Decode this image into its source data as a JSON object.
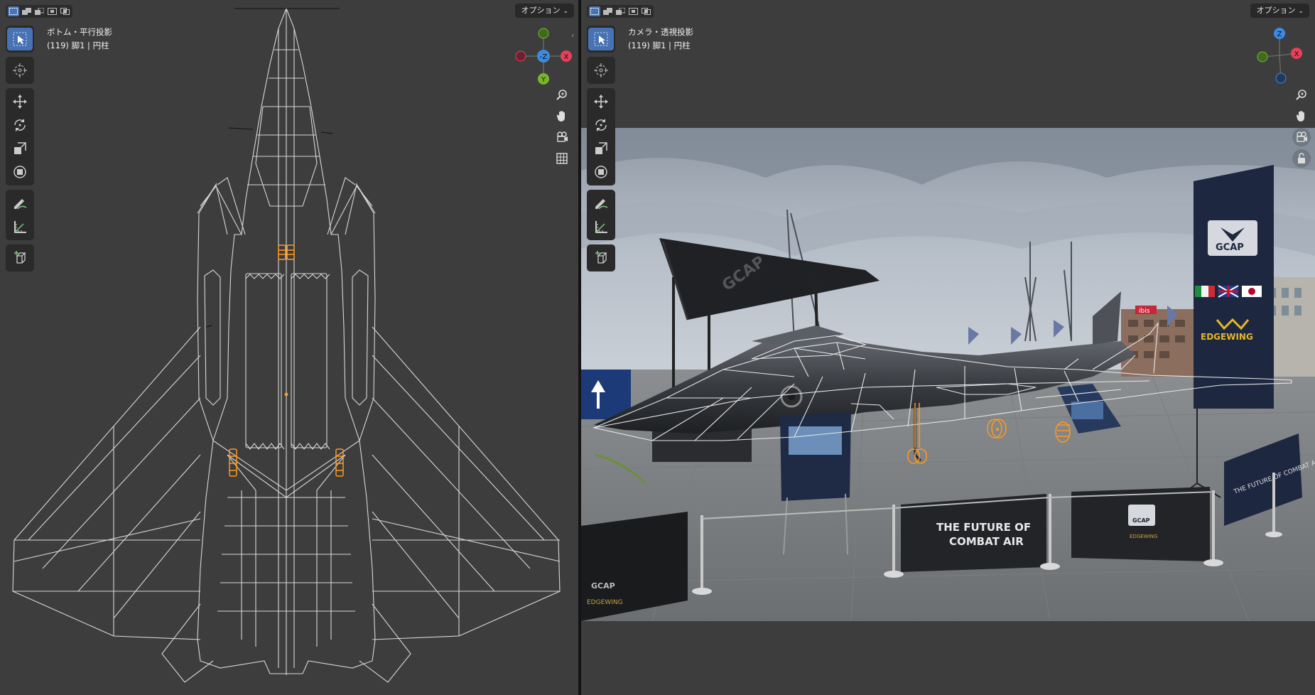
{
  "left_viewport": {
    "view_name": "ボトム・平行投影",
    "object_info": "(119) 脚1 | 円柱",
    "options_label": "オプション",
    "gizmo": {
      "z_label": "-Z",
      "x_label": "X",
      "y_label": "Y"
    }
  },
  "right_viewport": {
    "view_name": "カメラ・透視投影",
    "object_info": "(119) 脚1 | 円柱",
    "options_label": "オプション",
    "gizmo": {
      "z_label": "Z",
      "x_label": "X"
    },
    "scene_text": {
      "banner_brand": "GCAP",
      "banner_sub": "EDGEWING",
      "fence_line1": "THE FUTURE OF",
      "fence_line2": "COMBAT AIR",
      "fence_right": "THE FUTURE OF COMBAT AIR",
      "fence_left_brand": "GCAP",
      "fence_left_sub": "EDGEWING",
      "fence_mid_brand": "GCAP",
      "fence_mid_sub": "EDGEWING",
      "hotel_sign": "ibis"
    }
  },
  "colors": {
    "viewport_bg": "#3d3d3d",
    "active_tool": "#4772b3",
    "wire": "#d8d8d8",
    "selected": "#ff9a1f",
    "axis_x": "#e8405a",
    "axis_y": "#78b72a",
    "axis_z": "#3b8be0"
  }
}
